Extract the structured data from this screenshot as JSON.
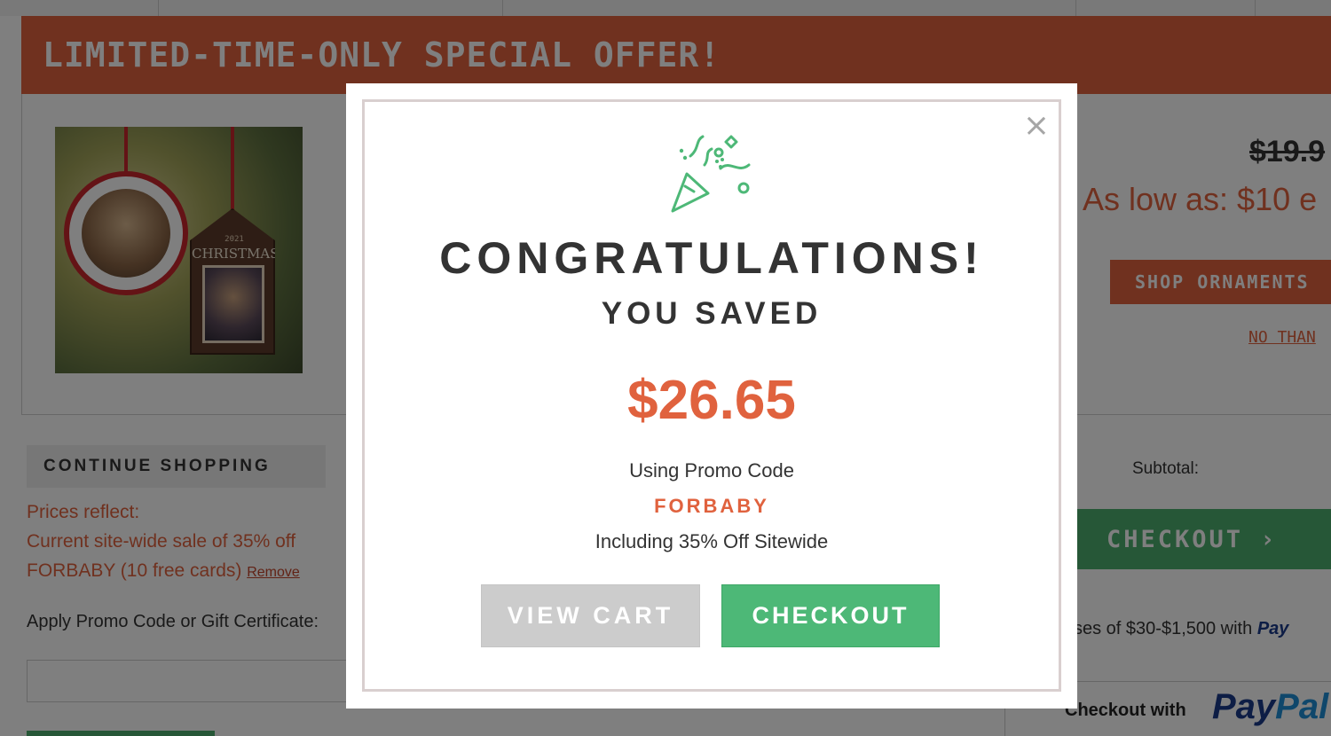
{
  "background_page": {
    "offer_banner": {
      "title": "LIMITED-TIME-ONLY SPECIAL OFFER!"
    },
    "ornament_tag": {
      "year": "2021",
      "word": "CHRISTMAS"
    },
    "offer": {
      "original_price": "$19.9",
      "as_low_as": "As low as: $10 e",
      "shop_button": "SHOP ORNAMENTS",
      "no_thanks": "NO THAN"
    },
    "cart": {
      "continue_shopping": "CONTINUE SHOPPING",
      "prices_reflect": "Prices reflect:",
      "sale_line": "Current site-wide sale of 35% off",
      "promo_line": "FORBABY (10 free cards)",
      "remove_link": "Remove",
      "apply_label": "Apply Promo Code or Gift Certificate:"
    },
    "summary": {
      "subtotal_label": "Subtotal:",
      "checkout_button": "CHECKOUT ›",
      "paypal_note_prefix": "ses of $30-$1,500 with",
      "paypal_note_brand": "Pay",
      "checkout_with": "Checkout with",
      "paypal_logo_a": "Pay",
      "paypal_logo_b": "Pal"
    }
  },
  "modal": {
    "close_symbol": "×",
    "icon": "party-popper-icon",
    "heading": "CONGRATULATIONS!",
    "subheading": "YOU SAVED",
    "amount": "$26.65",
    "promo_label": "Using Promo Code",
    "promo_code": "FORBABY",
    "including": "Including 35% Off Sitewide",
    "buttons": {
      "view_cart": "VIEW CART",
      "checkout": "CHECKOUT"
    }
  },
  "colors": {
    "accent_orange": "#e0623e",
    "checkout_green": "#4db877",
    "view_cart_gray": "#cccccc",
    "confetti_green": "#4db877",
    "text_dark": "#333333"
  }
}
